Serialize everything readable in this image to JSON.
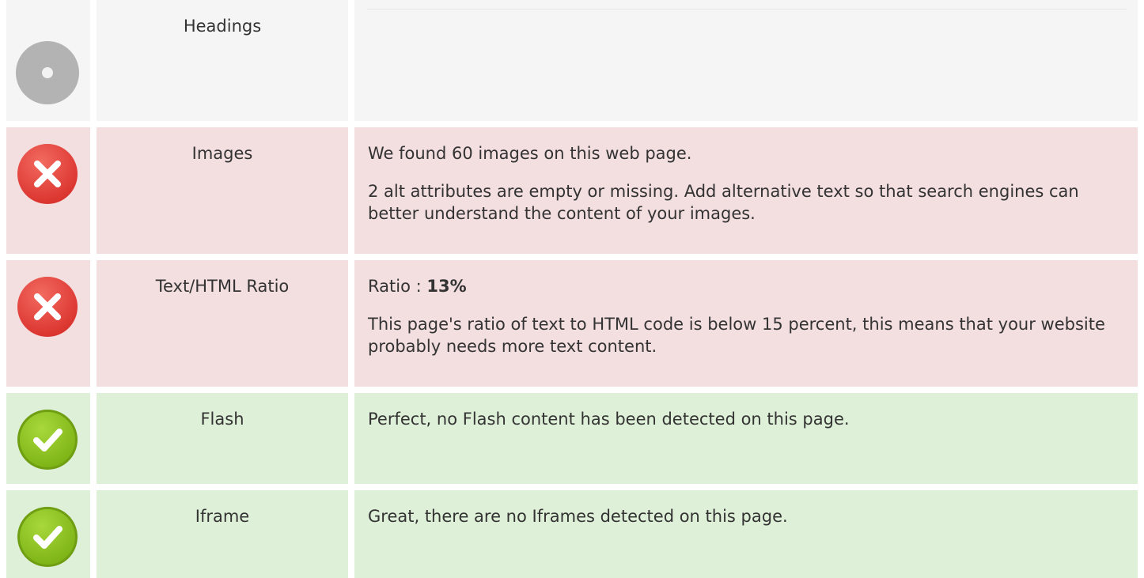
{
  "rows": [
    {
      "status": "neutral",
      "status_icon": "neutral-dot-icon",
      "name": "Headings",
      "lines": []
    },
    {
      "status": "error",
      "status_icon": "error-x-icon",
      "name": "Images",
      "lines": [
        "We found 60 images on this web page.",
        "2 alt attributes are empty or missing. Add alternative text so that search engines can better understand the content of your images."
      ]
    },
    {
      "status": "error",
      "status_icon": "error-x-icon",
      "name": "Text/HTML Ratio",
      "ratio_label": "Ratio : ",
      "ratio_value": "13%",
      "lines": [
        "This page's ratio of text to HTML code is below 15 percent, this means that your website probably needs more text content."
      ]
    },
    {
      "status": "ok",
      "status_icon": "success-check-icon",
      "name": "Flash",
      "lines": [
        "Perfect, no Flash content has been detected on this page."
      ]
    },
    {
      "status": "ok",
      "status_icon": "success-check-icon",
      "name": "Iframe",
      "lines": [
        "Great, there are no Iframes detected on this page."
      ]
    }
  ],
  "colors": {
    "neutral_bg": "#f5f5f5",
    "error_bg": "#f3dee0",
    "ok_bg": "#dff0d8",
    "error_icon": "#e0403b",
    "ok_icon": "#8cc21d",
    "neutral_icon": "#b3b3b3"
  }
}
